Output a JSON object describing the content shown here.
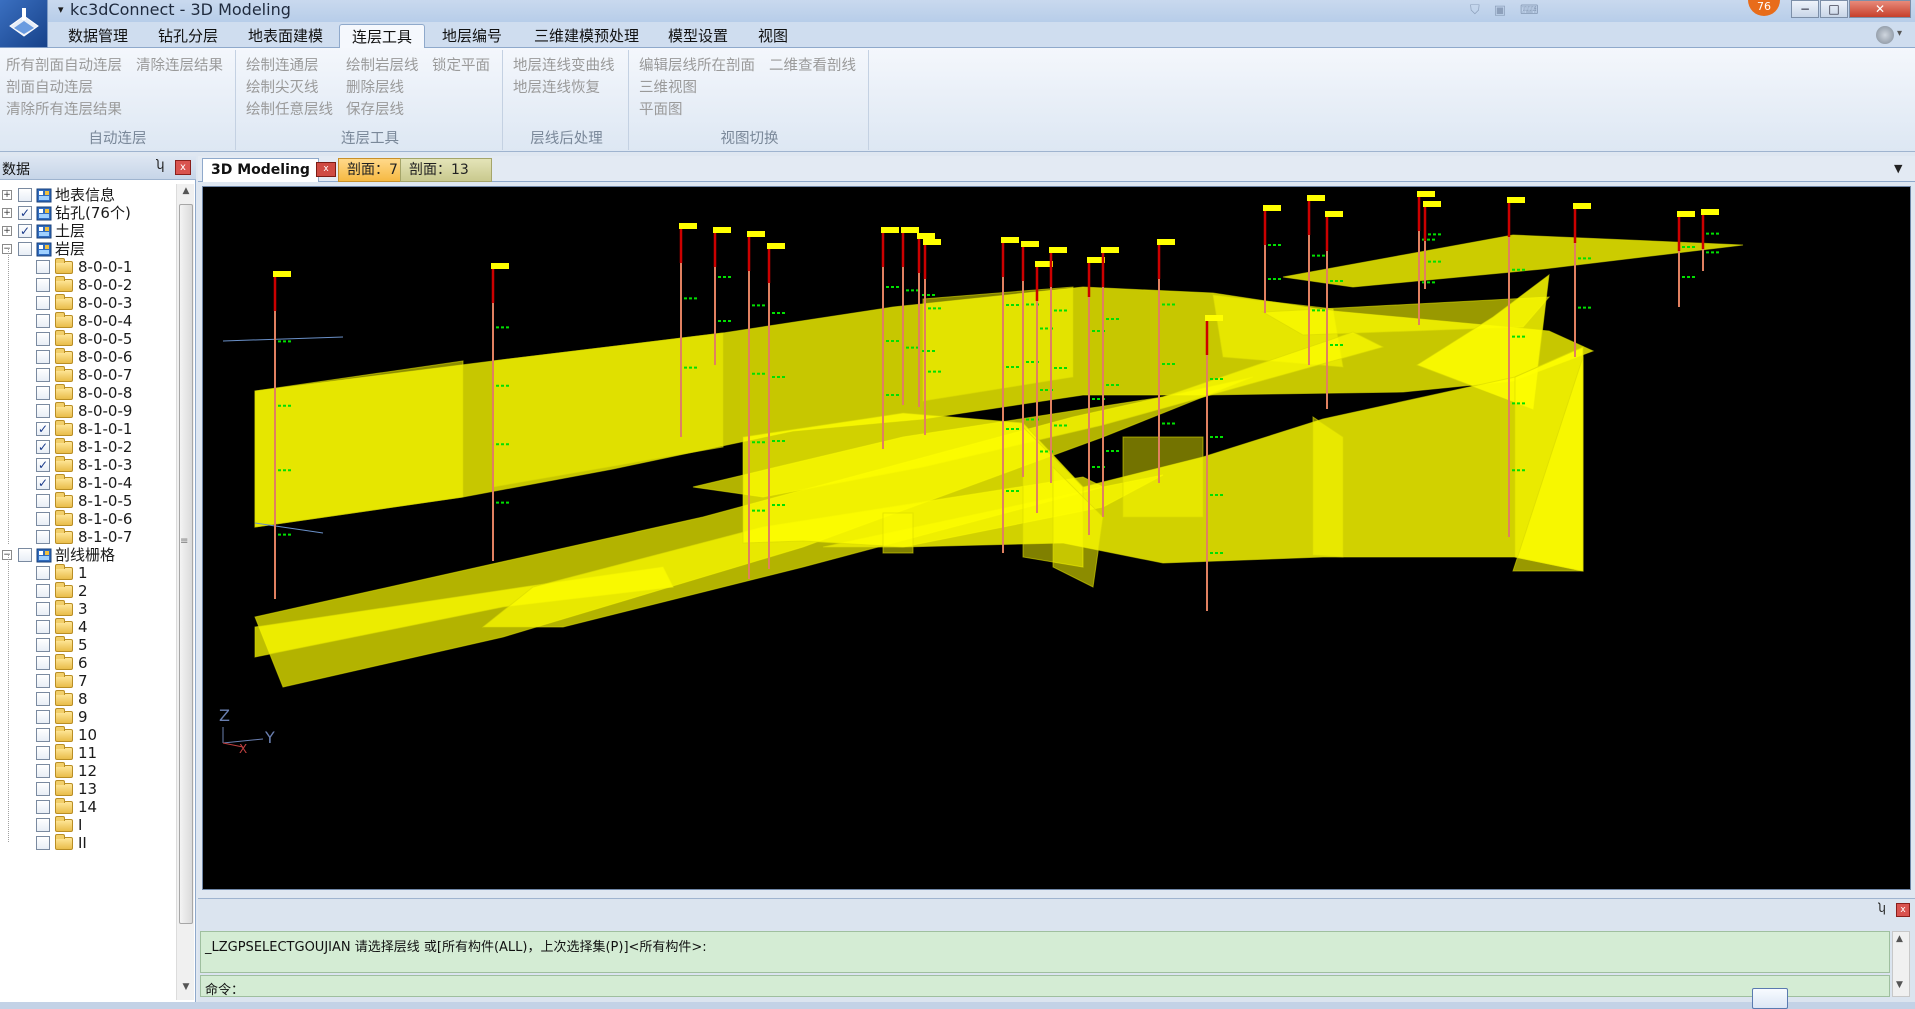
{
  "window": {
    "title": "kc3dConnect - 3D Modeling",
    "notification_count": "76",
    "minimize": "−",
    "maximize": "□",
    "close": "✕"
  },
  "ribbon_tabs": [
    "数据管理",
    "钻孔分层",
    "地表面建模",
    "连层工具",
    "地层编号",
    "三维建模预处理",
    "模型设置",
    "视图"
  ],
  "ribbon_active_tab": "连层工具",
  "ribbon_groups": {
    "auto_connect": {
      "label": "自动连层",
      "buttons": [
        "所有剖面自动连层",
        "清除连层结果",
        "剖面自动连层",
        "清除所有连层结果"
      ]
    },
    "connect_tools": {
      "label": "连层工具",
      "buttons": [
        "绘制连通层",
        "绘制岩层线",
        "锁定平面",
        "绘制尖灭线",
        "删除层线",
        "绘制任意层线",
        "保存层线"
      ]
    },
    "post_process": {
      "label": "层线后处理",
      "buttons": [
        "地层连线变曲线",
        "地层连线恢复"
      ]
    },
    "view_switch": {
      "label": "视图切换",
      "buttons": [
        "编辑层线所在剖面",
        "二维查看剖线",
        "三维视图",
        "平面图"
      ]
    }
  },
  "left_panel": {
    "title": "数据",
    "pin": "ʮ",
    "close": "x",
    "tree": {
      "root_nodes": [
        {
          "label": "地表信息",
          "checked": false,
          "expanded": false
        },
        {
          "label": "钻孔(76个)",
          "checked": true,
          "expanded": false
        },
        {
          "label": "土层",
          "checked": true,
          "expanded": false
        },
        {
          "label": "岩层",
          "checked": false,
          "expanded": true
        }
      ],
      "rock_layers": [
        {
          "label": "8-0-0-1",
          "checked": false
        },
        {
          "label": "8-0-0-2",
          "checked": false
        },
        {
          "label": "8-0-0-3",
          "checked": false
        },
        {
          "label": "8-0-0-4",
          "checked": false
        },
        {
          "label": "8-0-0-5",
          "checked": false
        },
        {
          "label": "8-0-0-6",
          "checked": false
        },
        {
          "label": "8-0-0-7",
          "checked": false
        },
        {
          "label": "8-0-0-8",
          "checked": false
        },
        {
          "label": "8-0-0-9",
          "checked": false
        },
        {
          "label": "8-1-0-1",
          "checked": true
        },
        {
          "label": "8-1-0-2",
          "checked": true
        },
        {
          "label": "8-1-0-3",
          "checked": true
        },
        {
          "label": "8-1-0-4",
          "checked": true
        },
        {
          "label": "8-1-0-5",
          "checked": false
        },
        {
          "label": "8-1-0-6",
          "checked": false
        },
        {
          "label": "8-1-0-7",
          "checked": false
        }
      ],
      "section_grid": {
        "label": "剖线栅格",
        "checked": false,
        "expanded": true
      },
      "sections": [
        "1",
        "2",
        "3",
        "4",
        "5",
        "6",
        "7",
        "8",
        "9",
        "10",
        "11",
        "12",
        "13",
        "14",
        "I",
        "II"
      ]
    }
  },
  "doc_tabs": {
    "main": "3D Modeling",
    "close": "x",
    "section_a": "剖面：7",
    "section_b": "剖面：13",
    "menu": "▼"
  },
  "viewport": {
    "axis_z": "Z",
    "axis_y": "Y",
    "axis_x": "X",
    "colors": {
      "background": "#000000",
      "layer": "#ffff00",
      "borehole": "#e08060",
      "marker": "#00e000",
      "top": "#cc0000"
    }
  },
  "command": {
    "history": "_LZGPSELECTGOUJIAN 请选择层线 或[所有构件(ALL)，上次选择集(P)]<所有构件>:",
    "prompt": "命令："
  }
}
